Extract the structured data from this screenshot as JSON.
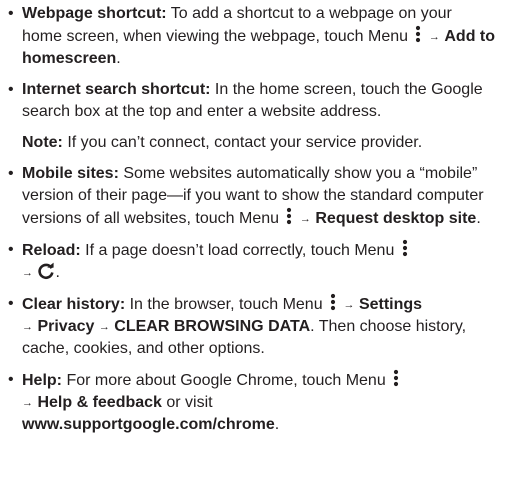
{
  "items": [
    {
      "title": "Webpage shortcut:",
      "text1": " To add a shortcut to a webpage on your home screen, when viewing the webpage, touch Menu ",
      "arrow": "→",
      "step1": "Add to homescreen",
      "end": "."
    },
    {
      "title": "Internet search shortcut:",
      "text1": " In the home screen, touch the Google search box at the top and enter a website address."
    },
    {
      "note_title": "Note:",
      "note_text": " If you can’t connect, contact your service provider."
    },
    {
      "title": "Mobile sites:",
      "text1": " Some websites automatically show you a “mobile” version of their page—if you want to show the standard computer versions of all websites, touch Menu ",
      "arrow": "→",
      "step1": "Request desktop site",
      "end": "."
    },
    {
      "title": "Reload:",
      "text1": " If a page doesn’t load correctly, touch Menu ",
      "arrow": "→",
      "end": "."
    },
    {
      "title": "Clear history:",
      "text1": " In the browser, touch Menu ",
      "arrow": "→",
      "step1": "Settings",
      "step2": "Privacy",
      "step3": "CLEAR BROWSING DATA",
      "text2": ". Then choose history, cache, cookies, and other options."
    },
    {
      "title": "Help:",
      "text1": " For more about Google Chrome, touch Menu ",
      "arrow": "→",
      "step1": "Help & feedback",
      "text2": " or visit",
      "link": "www.supportgoogle.com/chrome",
      "end": "."
    }
  ],
  "bullet": "•",
  "icons": {
    "menu": "menu-dots-icon",
    "reload": "reload-icon"
  }
}
